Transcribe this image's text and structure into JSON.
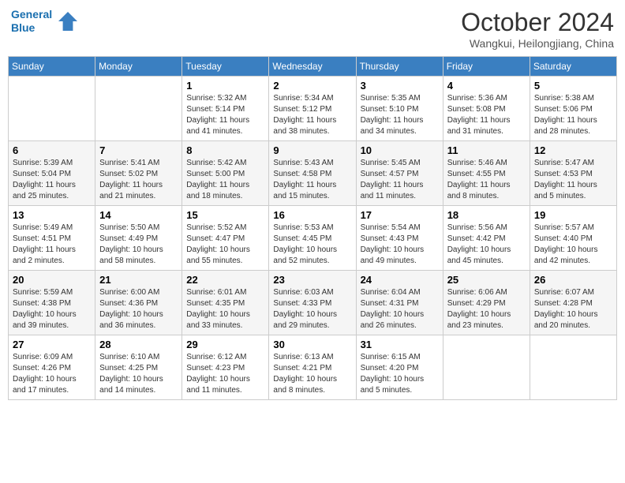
{
  "header": {
    "logo_line1": "General",
    "logo_line2": "Blue",
    "month": "October 2024",
    "location": "Wangkui, Heilongjiang, China"
  },
  "days_of_week": [
    "Sunday",
    "Monday",
    "Tuesday",
    "Wednesday",
    "Thursday",
    "Friday",
    "Saturday"
  ],
  "weeks": [
    [
      {
        "day": "",
        "info": ""
      },
      {
        "day": "",
        "info": ""
      },
      {
        "day": "1",
        "info": "Sunrise: 5:32 AM\nSunset: 5:14 PM\nDaylight: 11 hours and 41 minutes."
      },
      {
        "day": "2",
        "info": "Sunrise: 5:34 AM\nSunset: 5:12 PM\nDaylight: 11 hours and 38 minutes."
      },
      {
        "day": "3",
        "info": "Sunrise: 5:35 AM\nSunset: 5:10 PM\nDaylight: 11 hours and 34 minutes."
      },
      {
        "day": "4",
        "info": "Sunrise: 5:36 AM\nSunset: 5:08 PM\nDaylight: 11 hours and 31 minutes."
      },
      {
        "day": "5",
        "info": "Sunrise: 5:38 AM\nSunset: 5:06 PM\nDaylight: 11 hours and 28 minutes."
      }
    ],
    [
      {
        "day": "6",
        "info": "Sunrise: 5:39 AM\nSunset: 5:04 PM\nDaylight: 11 hours and 25 minutes."
      },
      {
        "day": "7",
        "info": "Sunrise: 5:41 AM\nSunset: 5:02 PM\nDaylight: 11 hours and 21 minutes."
      },
      {
        "day": "8",
        "info": "Sunrise: 5:42 AM\nSunset: 5:00 PM\nDaylight: 11 hours and 18 minutes."
      },
      {
        "day": "9",
        "info": "Sunrise: 5:43 AM\nSunset: 4:58 PM\nDaylight: 11 hours and 15 minutes."
      },
      {
        "day": "10",
        "info": "Sunrise: 5:45 AM\nSunset: 4:57 PM\nDaylight: 11 hours and 11 minutes."
      },
      {
        "day": "11",
        "info": "Sunrise: 5:46 AM\nSunset: 4:55 PM\nDaylight: 11 hours and 8 minutes."
      },
      {
        "day": "12",
        "info": "Sunrise: 5:47 AM\nSunset: 4:53 PM\nDaylight: 11 hours and 5 minutes."
      }
    ],
    [
      {
        "day": "13",
        "info": "Sunrise: 5:49 AM\nSunset: 4:51 PM\nDaylight: 11 hours and 2 minutes."
      },
      {
        "day": "14",
        "info": "Sunrise: 5:50 AM\nSunset: 4:49 PM\nDaylight: 10 hours and 58 minutes."
      },
      {
        "day": "15",
        "info": "Sunrise: 5:52 AM\nSunset: 4:47 PM\nDaylight: 10 hours and 55 minutes."
      },
      {
        "day": "16",
        "info": "Sunrise: 5:53 AM\nSunset: 4:45 PM\nDaylight: 10 hours and 52 minutes."
      },
      {
        "day": "17",
        "info": "Sunrise: 5:54 AM\nSunset: 4:43 PM\nDaylight: 10 hours and 49 minutes."
      },
      {
        "day": "18",
        "info": "Sunrise: 5:56 AM\nSunset: 4:42 PM\nDaylight: 10 hours and 45 minutes."
      },
      {
        "day": "19",
        "info": "Sunrise: 5:57 AM\nSunset: 4:40 PM\nDaylight: 10 hours and 42 minutes."
      }
    ],
    [
      {
        "day": "20",
        "info": "Sunrise: 5:59 AM\nSunset: 4:38 PM\nDaylight: 10 hours and 39 minutes."
      },
      {
        "day": "21",
        "info": "Sunrise: 6:00 AM\nSunset: 4:36 PM\nDaylight: 10 hours and 36 minutes."
      },
      {
        "day": "22",
        "info": "Sunrise: 6:01 AM\nSunset: 4:35 PM\nDaylight: 10 hours and 33 minutes."
      },
      {
        "day": "23",
        "info": "Sunrise: 6:03 AM\nSunset: 4:33 PM\nDaylight: 10 hours and 29 minutes."
      },
      {
        "day": "24",
        "info": "Sunrise: 6:04 AM\nSunset: 4:31 PM\nDaylight: 10 hours and 26 minutes."
      },
      {
        "day": "25",
        "info": "Sunrise: 6:06 AM\nSunset: 4:29 PM\nDaylight: 10 hours and 23 minutes."
      },
      {
        "day": "26",
        "info": "Sunrise: 6:07 AM\nSunset: 4:28 PM\nDaylight: 10 hours and 20 minutes."
      }
    ],
    [
      {
        "day": "27",
        "info": "Sunrise: 6:09 AM\nSunset: 4:26 PM\nDaylight: 10 hours and 17 minutes."
      },
      {
        "day": "28",
        "info": "Sunrise: 6:10 AM\nSunset: 4:25 PM\nDaylight: 10 hours and 14 minutes."
      },
      {
        "day": "29",
        "info": "Sunrise: 6:12 AM\nSunset: 4:23 PM\nDaylight: 10 hours and 11 minutes."
      },
      {
        "day": "30",
        "info": "Sunrise: 6:13 AM\nSunset: 4:21 PM\nDaylight: 10 hours and 8 minutes."
      },
      {
        "day": "31",
        "info": "Sunrise: 6:15 AM\nSunset: 4:20 PM\nDaylight: 10 hours and 5 minutes."
      },
      {
        "day": "",
        "info": ""
      },
      {
        "day": "",
        "info": ""
      }
    ]
  ]
}
